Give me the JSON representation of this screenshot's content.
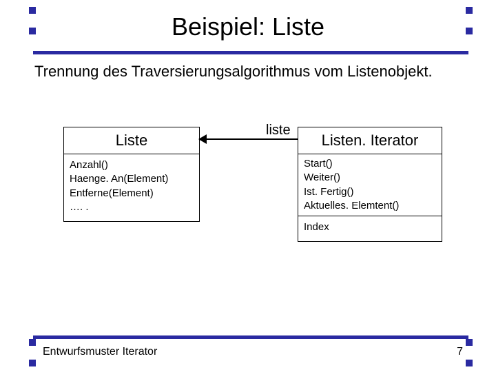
{
  "title": "Beispiel: Liste",
  "body": "Trennung des Traversierungsalgorithmus vom Listenobjekt.",
  "assoc_label": "liste",
  "uml": {
    "liste": {
      "name": "Liste",
      "ops": "Anzahl()\nHaenge. An(Element)\nEntferne(Element)\n…. ."
    },
    "iterator": {
      "name": "Listen. Iterator",
      "ops": "Start()\nWeiter()\nIst. Fertig()\nAktuelles. Elemtent()",
      "attrs": "Index"
    }
  },
  "footer": {
    "left": "Entwurfsmuster Iterator",
    "page": "7"
  }
}
